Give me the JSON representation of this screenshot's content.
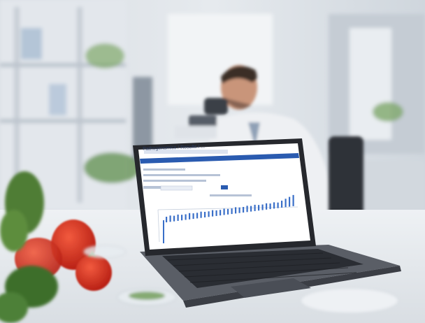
{
  "scene": {
    "description_kind": "photo",
    "subject": "scientist-with-microscope",
    "foreground_object": "laptop",
    "props": [
      "tomato",
      "plant-leaves",
      "petri-dish",
      "glassware"
    ]
  },
  "laptop_screen": {
    "title": "Pathogenomics / Results / ...",
    "header_bar_color": "#2a5bb0",
    "chart": {
      "type": "bar",
      "bar_color": "#3a6fc8"
    }
  },
  "colors": {
    "lab_background": "#dfe4ea",
    "laptop_body": "#3a3d44",
    "screen_bg": "#ffffff",
    "tomato": "#d8281e",
    "lab_coat": "#eef0f3",
    "table": "#e9edf1"
  }
}
